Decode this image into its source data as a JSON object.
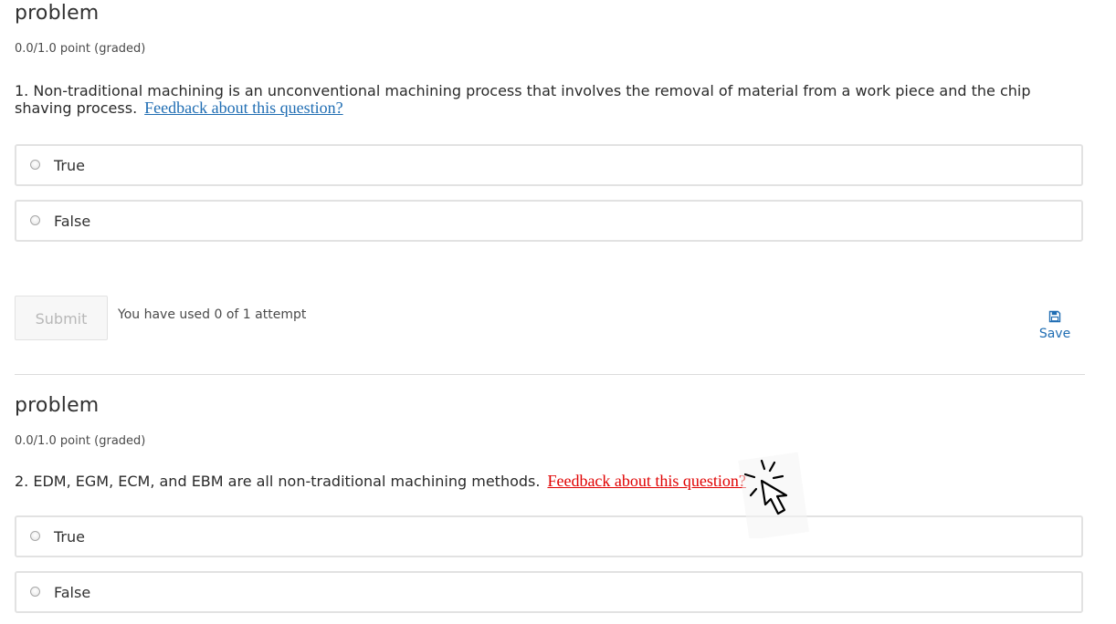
{
  "problems": [
    {
      "title": "problem",
      "points": "0.0/1.0 point (graded)",
      "question": "1. Non-traditional machining is an unconventional machining process that involves the removal of material from a work piece and the chip shaving process.",
      "feedback_link": "Feedback about this question?",
      "feedback_color": "#1f6db3",
      "choices": [
        "True",
        "False"
      ],
      "submit_label": "Submit",
      "attempts_text": "You have used 0 of 1 attempt",
      "save_label": "Save",
      "save_icon": "floppy-disk-icon"
    },
    {
      "title": "problem",
      "points": "0.0/1.0 point (graded)",
      "question": "2. EDM, EGM, ECM, and EBM are all non-traditional machining methods.",
      "feedback_link": "Feedback about this question?",
      "feedback_color": "#e00000",
      "choices": [
        "True",
        "False"
      ]
    }
  ],
  "cursor_icon": "click-cursor-icon"
}
